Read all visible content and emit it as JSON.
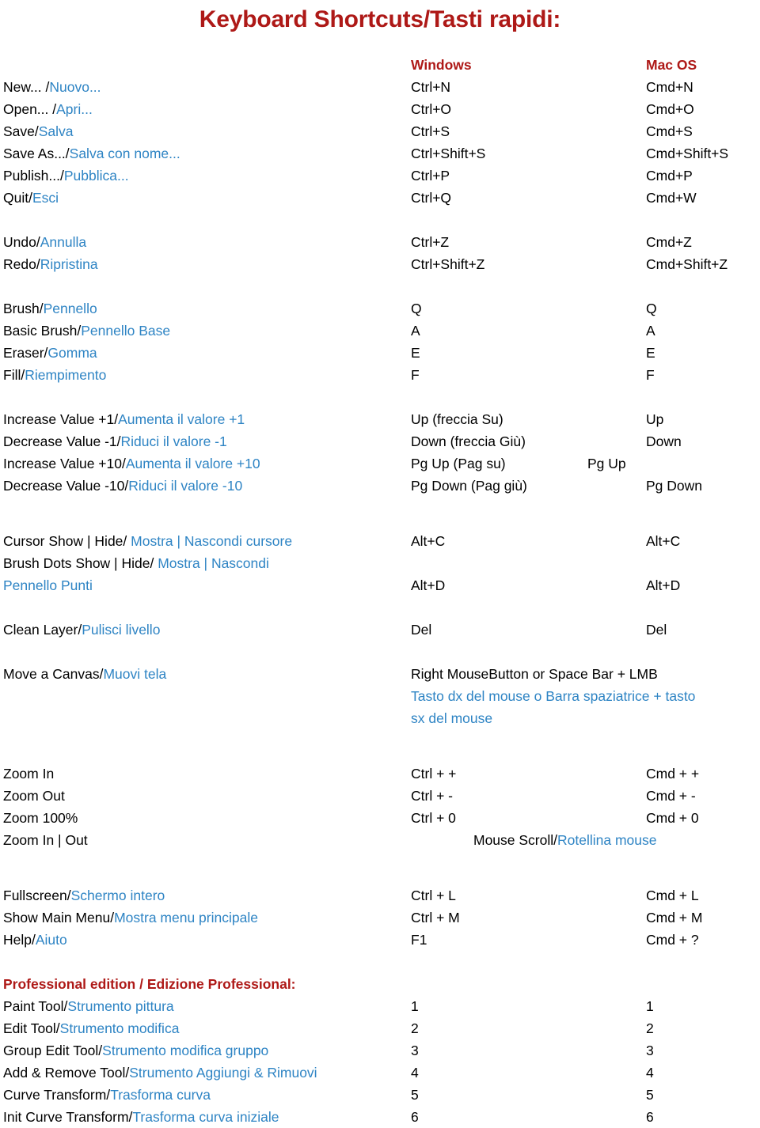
{
  "title": "Keyboard Shortcuts/Tasti rapidi:",
  "columns": {
    "windows": "Windows",
    "macos": "Mac OS"
  },
  "groups": [
    {
      "name": "file-commands",
      "rows": [
        {
          "en": "New... /",
          "it": "Nuovo...",
          "win": "Ctrl+N",
          "mac": "Cmd+N"
        },
        {
          "en": "Open... /",
          "it": "Apri...",
          "win": "Ctrl+O",
          "mac": "Cmd+O"
        },
        {
          "en": "Save/",
          "it": "Salva",
          "win": "Ctrl+S",
          "mac": "Cmd+S"
        },
        {
          "en": "Save As.../",
          "it": "Salva con nome...",
          "win": "Ctrl+Shift+S",
          "mac": "Cmd+Shift+S"
        },
        {
          "en": "Publish.../",
          "it": "Pubblica...",
          "win": "Ctrl+P",
          "mac": "Cmd+P"
        },
        {
          "en": "Quit/",
          "it": "Esci",
          "win": "Ctrl+Q",
          "mac": "Cmd+W"
        }
      ]
    },
    {
      "name": "history-commands",
      "rows": [
        {
          "en": "Undo/",
          "it": "Annulla",
          "win": "Ctrl+Z",
          "mac": "Cmd+Z"
        },
        {
          "en": "Redo/",
          "it": "Ripristina",
          "win": "Ctrl+Shift+Z",
          "mac": "Cmd+Shift+Z"
        }
      ]
    },
    {
      "name": "tool-commands",
      "rows": [
        {
          "en": "Brush/",
          "it": "Pennello",
          "win": "Q",
          "mac": "Q"
        },
        {
          "en": "Basic Brush/",
          "it": "Pennello Base",
          "win": "A",
          "mac": "A"
        },
        {
          "en": "Eraser/",
          "it": "Gomma",
          "win": "E",
          "mac": "E"
        },
        {
          "en": "Fill/",
          "it": "Riempimento",
          "win": "F",
          "mac": "F"
        }
      ]
    },
    {
      "name": "value-commands",
      "rows": [
        {
          "en": "Increase Value +1/",
          "it": "Aumenta il valore +1",
          "win": "Up (freccia Su)",
          "mac": "Up"
        },
        {
          "en": "Decrease Value  -1/",
          "it": "Riduci il valore -1",
          "win": "Down (freccia Giù)",
          "mac": "Down"
        },
        {
          "en": "Increase Value +10/",
          "it": "Aumenta il valore +10",
          "win": "Pg Up   (Pag su)",
          "mac": "Pg Up",
          "mac_shift": true
        },
        {
          "en": "Decrease Value -10/",
          "it": "Riduci il valore -10",
          "win": "Pg Down (Pag giù)",
          "mac": "Pg Down"
        }
      ]
    }
  ],
  "cursor_section": {
    "line1": {
      "en": "Cursor Show | Hide/ ",
      "it": "Mostra | Nascondi cursore",
      "win": "Alt+C",
      "mac": "Alt+C"
    },
    "line2": {
      "en": "Brush Dots Show | Hide/ ",
      "it": "Mostra | Nascondi"
    },
    "line3": {
      "it": "Pennello Punti",
      "win": "Alt+D",
      "mac": "Alt+D"
    }
  },
  "clean_layer": {
    "en": "Clean Layer/",
    "it": "Pulisci livello",
    "win": "Del",
    "mac": "Del"
  },
  "move_canvas": {
    "en": "Move a Canvas/",
    "it": "Muovi tela",
    "shortcut_en": "Right MouseButton or Space Bar + LMB",
    "shortcut_it_line1": "Tasto dx del mouse o Barra spaziatrice + tasto",
    "shortcut_it_line2": "sx del mouse"
  },
  "zoom_section": {
    "rows": [
      {
        "en": "Zoom In",
        "win": "Ctrl + +",
        "mac": "Cmd + +"
      },
      {
        "en": "Zoom Out",
        "win": "Ctrl + -",
        "mac": "Cmd + -"
      },
      {
        "en": "Zoom 100%",
        "win": "Ctrl + 0",
        "mac": "Cmd + 0"
      }
    ],
    "scroll_row": {
      "en": "Zoom In | Out",
      "shortcut_en": "Mouse Scroll/",
      "shortcut_it": "Rotellina mouse"
    }
  },
  "window_section": {
    "rows": [
      {
        "en": "Fullscreen/",
        "it": "Schermo intero",
        "win": "Ctrl + L",
        "mac": "Cmd + L"
      },
      {
        "en": "Show Main Menu/",
        "it": "Mostra menu principale",
        "win": "Ctrl + M",
        "mac": "Cmd + M"
      },
      {
        "en": "Help/",
        "it": "Aiuto",
        "win": "F1",
        "mac": "Cmd + ?"
      }
    ]
  },
  "professional": {
    "heading": "Professional edition / Edizione Professional:",
    "rows": [
      {
        "en": "Paint Tool/",
        "it": "Strumento pittura",
        "win": "1",
        "mac": "1"
      },
      {
        "en": "Edit Tool/",
        "it": "Strumento modifica",
        "win": "2",
        "mac": "2"
      },
      {
        "en": "Group Edit Tool/",
        "it": "Strumento modifica gruppo",
        "win": "3",
        "mac": "3"
      },
      {
        "en": "Add & Remove Tool/",
        "it": "Strumento Aggiungi & Rimuovi",
        "win": "4",
        "mac": "4"
      },
      {
        "en": "Curve Transform/",
        "it": "Trasforma curva",
        "win": "5",
        "mac": "5"
      },
      {
        "en": "Init Curve Transform/",
        "it": "Trasforma curva iniziale",
        "win": "6",
        "mac": "6"
      }
    ]
  },
  "colors": {
    "accent_red": "#AE1917",
    "italian_blue": "#2E84C4",
    "english_black": "#000000"
  }
}
